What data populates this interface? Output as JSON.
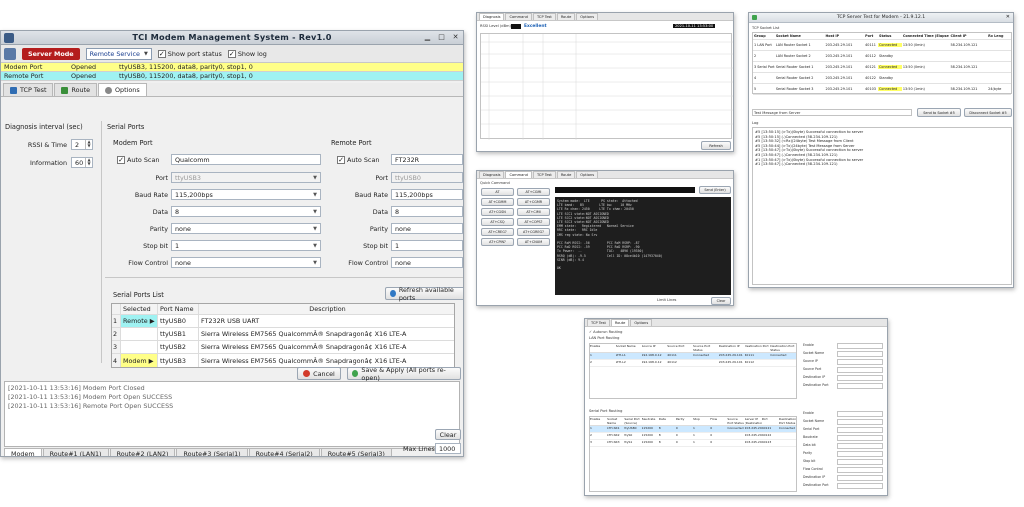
{
  "main": {
    "title": "TCI Modem Management System - Rev1.0",
    "toolbar": {
      "server_mode": "Server Mode",
      "service": "Remote Service",
      "show_port_status": "Show port status",
      "show_log": "Show log"
    },
    "ports": [
      {
        "name": "Modem Port",
        "state": "Opened",
        "info": "ttyUSB3, 115200, data8, parity0, stop1, 0"
      },
      {
        "name": "Remote Port",
        "state": "Opened",
        "info": "ttyUSB0, 115200, data8, parity0, stop1, 0"
      }
    ],
    "tabs": [
      "TCP Test",
      "Route",
      "Options"
    ],
    "diag_label": "Diagnosis interval (sec)",
    "rssi_label": "RSSI & Time",
    "rssi_value": "2",
    "info_label": "Information",
    "info_value": "60",
    "serial_ports": "Serial Ports",
    "modem": {
      "group": "Modem Port",
      "auto_scan": "Auto Scan",
      "auto_value": "Qualcomm",
      "port": "ttyUSB3",
      "baud": "115,200bps",
      "data": "8",
      "parity": "none",
      "stop": "1",
      "flow": "none"
    },
    "remote": {
      "group": "Remote Port",
      "auto_scan": "Auto Scan",
      "auto_value": "FT232R",
      "port": "ttyUSB0",
      "baud": "115,200bps",
      "data": "8",
      "parity": "none",
      "stop": "1",
      "flow": "none"
    },
    "field_labels": {
      "port": "Port",
      "baud": "Baud Rate",
      "data": "Data",
      "parity": "Parity",
      "stop": "Stop bit",
      "flow": "Flow Control"
    },
    "list_title": "Serial Ports List",
    "refresh": "Refresh available ports",
    "table": {
      "headers": [
        "Selected",
        "Port Name",
        "Description"
      ],
      "rows": [
        {
          "n": "1",
          "sel": "Remote ▶",
          "port": "ttyUSB0",
          "desc": "FT232R USB UART"
        },
        {
          "n": "2",
          "sel": "",
          "port": "ttyUSB1",
          "desc": "Sierra Wireless EM7565 QualcommÂ® Snapdragonâ¢ X16 LTE-A"
        },
        {
          "n": "3",
          "sel": "",
          "port": "ttyUSB2",
          "desc": "Sierra Wireless EM7565 QualcommÂ® Snapdragonâ¢ X16 LTE-A"
        },
        {
          "n": "4",
          "sel": "Modem ▶",
          "port": "ttyUSB3",
          "desc": "Sierra Wireless EM7565 QualcommÂ® Snapdragonâ¢ X16 LTE-A"
        }
      ]
    },
    "cancel": "Cancel",
    "save": "Save & Apply (All ports re-open)",
    "log": [
      "[2021-10-11 13:53:16] Modem Port Closed",
      "[2021-10-11 13:53:16] Modem Port Open SUCCESS",
      "[2021-10-11 13:53:16] Remote Port Open SUCCESS"
    ],
    "bottom_tabs": [
      "Modem",
      "Route#1 (LAN1)",
      "Route#2 (LAN2)",
      "Route#3 (Serial1)",
      "Route#4 (Serial2)",
      "Route#5 (Serial3)"
    ],
    "max_lines_label": "Max Lines",
    "max_lines": "1000",
    "clear": "Clear"
  },
  "diag": {
    "tabs": [
      "Diagnosis",
      "Command",
      "TCP Test",
      "Route",
      "Options"
    ],
    "rssi": "Excellent",
    "datetime": "2021-10-11 13:53:00",
    "refresh": "Refresh"
  },
  "cmd": {
    "tabs": [
      "Diagnosis",
      "Command",
      "TCP Test",
      "Route",
      "Options"
    ],
    "quick": "Quick Command",
    "send": "Send (Enter)",
    "buttons": [
      "AT",
      "AT+CGMI",
      "AT+CGMM",
      "AT+CGMR",
      "AT+CGSN",
      "AT+CIMI",
      "AT+CSQ",
      "AT+COPS?",
      "AT+CREG?",
      "AT+CGREG?",
      "AT+CPIN?",
      "AT+CNUM"
    ],
    "terminal": "System mode:  LTE      PS state:  Attached\nLTE band:   B5        LTE bw:    10 MHz\nLTE Rx chan: 2450     LTE Tx chan: 20450\nLTE SCC1 state:NOT ASSIGNED\nLTE SCC2 state:NOT ASSIGNED\nLTE SCC3 state:NOT ASSIGNED\nEMM state:   Registered   Normal Service\nRRC state:   RRC Idle\nIMS reg state: No Srv\n\nPCC RxM RSSI: -56         PCC RxM RSRP: -87\nPCC RxD RSSI: -59         PCC RxD RSRP: -90\nTx Power:  --             TAC:   4B96 (19350)\nRSRQ (dB): -9.5           Cell ID: 08ce4b10 (147937040)\nSINR (dB): 9.4\n\nOK",
    "limit": "Limit Lines",
    "clear": "Clear"
  },
  "tcp": {
    "title": "TCP Server Test for Modem - 21.9.12.1",
    "list_label": "TCP Socket List",
    "headers": [
      "Group",
      "Socket Name",
      "Host IP",
      "Port",
      "Status",
      "Connected Time (Elapsed)",
      "Client IP",
      "Rx Leng"
    ],
    "rows": [
      {
        "n": "1",
        "group": "LAN Port",
        "name": "LAN Router Socket 1",
        "ip": "203.245.29.101",
        "port": "40111",
        "status": "Connected",
        "time": "13:50 (0min)",
        "client": "58.234.109.121",
        "rx": ""
      },
      {
        "n": "2",
        "group": "",
        "name": "LAN Router Socket 2",
        "ip": "203.245.29.101",
        "port": "40112",
        "status": "Standby",
        "time": "",
        "client": "",
        "rx": ""
      },
      {
        "n": "3",
        "group": "Serial Port",
        "name": "Serial Router Socket 1",
        "ip": "203.245.29.101",
        "port": "40121",
        "status": "Connected",
        "time": "13:50 (0min)",
        "client": "58.234.109.121",
        "rx": ""
      },
      {
        "n": "4",
        "group": "",
        "name": "Serial Router Socket 2",
        "ip": "203.245.29.101",
        "port": "40122",
        "status": "Standby",
        "time": "",
        "client": "",
        "rx": ""
      },
      {
        "n": "5",
        "group": "",
        "name": "Serial Router Socket 3",
        "ip": "203.245.29.101",
        "port": "40103",
        "status": "Connected",
        "time": "13:50 (1min)",
        "client": "58.234.109.121",
        "rx": "24(byte"
      }
    ],
    "message": "Test Message from Server",
    "send_btn": "Send to Socket #5",
    "disconnect_btn": "Disconnect Socket #5",
    "log_label": "Log",
    "log": [
      "#5 [13:50:15] (>Tx)(0byte) Successful connection to server",
      "#5 [13:50:15] (-)Connected (58.234.109.121)",
      "#5 [13:50:32] (<Rx)(24byte) Test Message from Client",
      "#5 [13:50:44] (>Tx)(24byte) Test Message from Server",
      "#3 [13:50:47] (>Tx)(0byte) Successful connection to server",
      "#3 [13:50:47] (-)Connected (58.234.109.121)",
      "#1 [13:50:47] (>Tx)(0byte) Successful connection to server",
      "#1 [13:50:47] (-)Connected (58.234.109.121)"
    ]
  },
  "route": {
    "tabs": [
      "TCP Test",
      "Route",
      "Options"
    ],
    "autorun": "Autorun Routing",
    "lan_label": "LAN Port Routing",
    "lan_headers": [
      "Enable",
      "Socket Name",
      "Source IP",
      "Source Port",
      "Source Port Status",
      "Destination IP",
      "Destination Port",
      "Destination Port Status"
    ],
    "lan_rows": [
      [
        "1",
        "LTH-L1",
        "192.168.0.12",
        "40111",
        "Connected",
        "203.245.29.101",
        "40111",
        "Connected"
      ],
      [
        "2",
        "LTH-L2",
        "192.168.0.12",
        "40112",
        "",
        "203.245.29.101",
        "40112",
        ""
      ]
    ],
    "serial_label": "Serial Port Routing",
    "serial_headers": [
      "Enable",
      "Socket Name",
      "Serial Port (Source)",
      "Baudrate",
      "Data",
      "Parity",
      "Stop",
      "Flow",
      "Source Port Status",
      "Server IP (Destination)",
      "Port",
      "Destination Port Status"
    ],
    "serial_rows": [
      [
        "1",
        "LTH-SR1",
        "ttyUSB0",
        "115200",
        "8",
        "0",
        "1",
        "0",
        "Connected",
        "203.245.29.101",
        "40121",
        "Connected"
      ],
      [
        "2",
        "LTH-SR2",
        "ttyS0",
        "115200",
        "8",
        "0",
        "1",
        "0",
        "",
        "203.245.29.101",
        "40122",
        ""
      ],
      [
        "3",
        "LTH-SR3",
        "ttyS1",
        "115200",
        "8",
        "0",
        "1",
        "0",
        "",
        "203.245.29.101",
        "40123",
        ""
      ]
    ],
    "side_lan": [
      "Enable",
      "Socket Name",
      "Source IP",
      "Source Port",
      "Destination IP",
      "Destination Port"
    ],
    "side_serial": [
      "Enable",
      "Socket Name",
      "Serial Port",
      "Baudrate",
      "Data bit",
      "Parity",
      "Stop bit",
      "Flow Control",
      "Destination IP",
      "Destination Port"
    ]
  }
}
